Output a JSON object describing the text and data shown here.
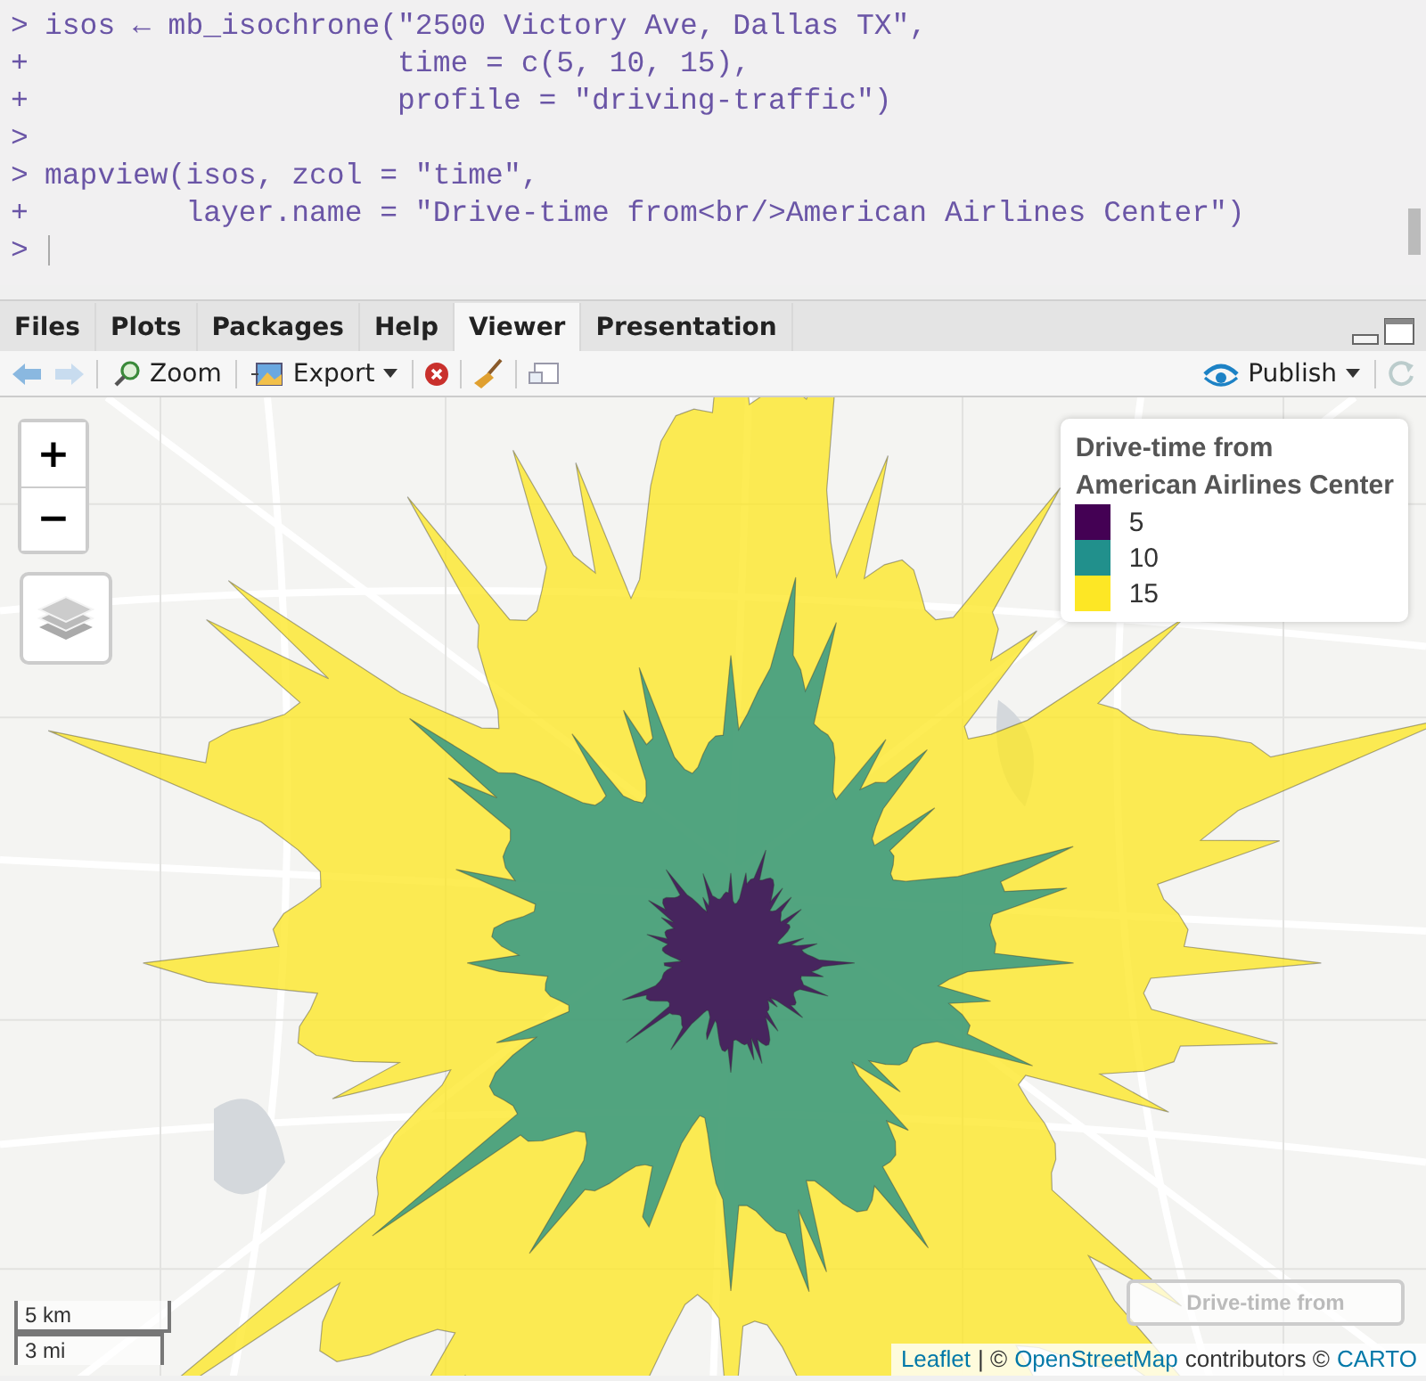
{
  "console": {
    "lines": [
      {
        "prompt": ">",
        "code": "isos ← mb_isochrone(\"2500 Victory Ave, Dallas TX\","
      },
      {
        "prompt": "+",
        "code": "                    time = c(5, 10, 15),"
      },
      {
        "prompt": "+",
        "code": "                    profile = \"driving-traffic\")"
      },
      {
        "prompt": ">"
      },
      {
        "prompt": ">",
        "code": "mapview(isos, zcol = \"time\","
      },
      {
        "prompt": "+",
        "code": "        layer.name = \"Drive-time from<br/>American Airlines Center\")"
      },
      {
        "prompt": ">"
      }
    ]
  },
  "tabs": [
    {
      "label": "Files",
      "selected": false
    },
    {
      "label": "Plots",
      "selected": false
    },
    {
      "label": "Packages",
      "selected": false
    },
    {
      "label": "Help",
      "selected": false
    },
    {
      "label": "Viewer",
      "selected": true
    },
    {
      "label": "Presentation",
      "selected": false
    }
  ],
  "toolbar": {
    "zoom": "Zoom",
    "export": "Export",
    "publish": "Publish"
  },
  "map": {
    "legend": {
      "title_lines": [
        "Drive-time from",
        "American Airlines Center"
      ],
      "items": [
        {
          "label": "5",
          "color": "#440154"
        },
        {
          "label": "10",
          "color": "#21908c"
        },
        {
          "label": "15",
          "color": "#fde725"
        }
      ]
    },
    "zoom_in": "+",
    "zoom_out": "−",
    "layer_control": "Drive-time from",
    "scale": [
      "5 km",
      "3 mi"
    ],
    "attribution": [
      {
        "text": "Leaflet",
        "link": true
      },
      {
        "text": "| ©",
        "link": false
      },
      {
        "text": "OpenStreetMap",
        "link": true
      },
      {
        "text": "contributors ©",
        "link": false
      },
      {
        "text": "CARTO",
        "link": true
      }
    ]
  }
}
